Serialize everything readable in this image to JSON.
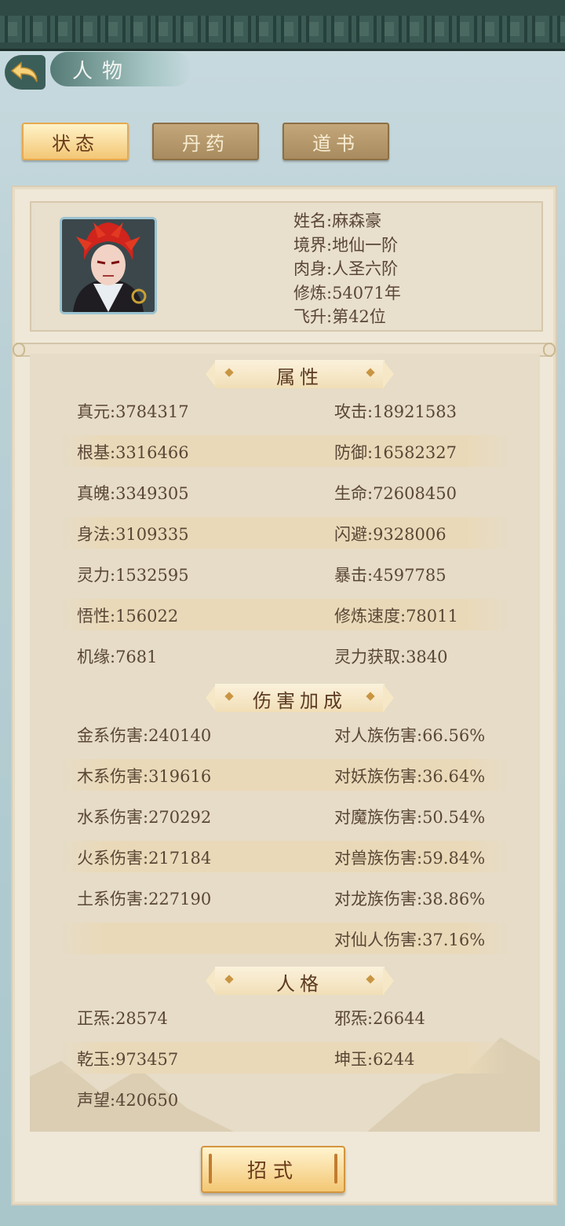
{
  "header": {
    "title": "人物"
  },
  "tabs": [
    {
      "label": "状态",
      "active": true
    },
    {
      "label": "丹药",
      "active": false
    },
    {
      "label": "道书",
      "active": false
    }
  ],
  "profile": {
    "name": "姓名:麻森豪",
    "realm": "境界:地仙一阶",
    "body": "肉身:人圣六阶",
    "cultivation": "修炼:54071年",
    "ascension": "飞升:第42位"
  },
  "sections": {
    "attributes": {
      "title": "属性",
      "rows": [
        {
          "left": "真元:3784317",
          "right": "攻击:18921583"
        },
        {
          "left": "根基:3316466",
          "right": "防御:16582327"
        },
        {
          "left": "真魄:3349305",
          "right": "生命:72608450"
        },
        {
          "left": "身法:3109335",
          "right": "闪避:9328006"
        },
        {
          "left": "灵力:1532595",
          "right": "暴击:4597785"
        },
        {
          "left": "悟性:156022",
          "right": "修炼速度:78011"
        },
        {
          "left": "机缘:7681",
          "right": "灵力获取:3840"
        }
      ]
    },
    "damage": {
      "title": "伤害加成",
      "rows": [
        {
          "left": "金系伤害:240140",
          "right": "对人族伤害:66.56%"
        },
        {
          "left": "木系伤害:319616",
          "right": "对妖族伤害:36.64%"
        },
        {
          "left": "水系伤害:270292",
          "right": "对魔族伤害:50.54%"
        },
        {
          "left": "火系伤害:217184",
          "right": "对兽族伤害:59.84%"
        },
        {
          "left": "土系伤害:227190",
          "right": "对龙族伤害:38.86%"
        },
        {
          "left": "",
          "right": "对仙人伤害:37.16%"
        }
      ]
    },
    "personality": {
      "title": "人格",
      "rows": [
        {
          "left": "正炁:28574",
          "right": "邪炁:26644"
        },
        {
          "left": "乾玉:973457",
          "right": "坤玉:6244"
        },
        {
          "left": "声望:420650",
          "right": ""
        }
      ]
    }
  },
  "footer": {
    "skill_button": "招式"
  },
  "colors": {
    "accent": "#f3c775",
    "text": "#5a4636",
    "band": "#ead9b8"
  }
}
